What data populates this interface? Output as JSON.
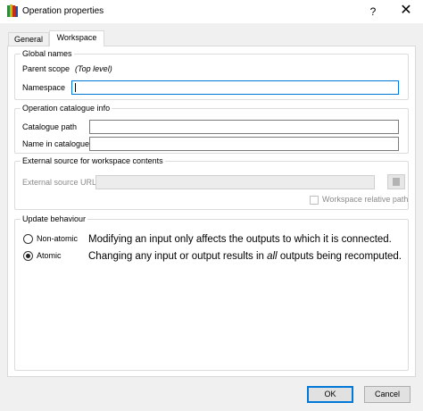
{
  "window": {
    "title": "Operation properties",
    "help_glyph": "?",
    "close_glyph": "✕"
  },
  "tabs": [
    {
      "label": "General",
      "selected": false
    },
    {
      "label": "Workspace",
      "selected": true
    }
  ],
  "global_names": {
    "title": "Global names",
    "parent_scope_label": "Parent scope",
    "parent_scope_value": "(Top level)",
    "namespace_label": "Namespace",
    "namespace_value": ""
  },
  "catalogue": {
    "title": "Operation catalogue info",
    "path_label": "Catalogue path",
    "path_value": "",
    "name_label": "Name in catalogue",
    "name_value": ""
  },
  "external_source": {
    "title": "External source for workspace contents",
    "url_label": "External source URL",
    "url_value": "",
    "relative_label": "Workspace relative path",
    "relative_checked": false
  },
  "update_behaviour": {
    "title": "Update behaviour",
    "options": [
      {
        "label": "Non-atomic",
        "selected": false,
        "desc_before": "Modifying an input only affects the outputs to which it is connected.",
        "desc_em": "",
        "desc_after": ""
      },
      {
        "label": "Atomic",
        "selected": true,
        "desc_before": "Changing any input or output results in ",
        "desc_em": "all",
        "desc_after": " outputs being recomputed."
      }
    ]
  },
  "buttons": {
    "ok": "OK",
    "cancel": "Cancel"
  },
  "colors": {
    "focus": "#0078d7",
    "dialog_bg": "#f0f0f0"
  },
  "icons": {
    "app": "app-logo-icon",
    "help": "help-icon",
    "close": "close-icon",
    "browse": "browse-icon"
  }
}
